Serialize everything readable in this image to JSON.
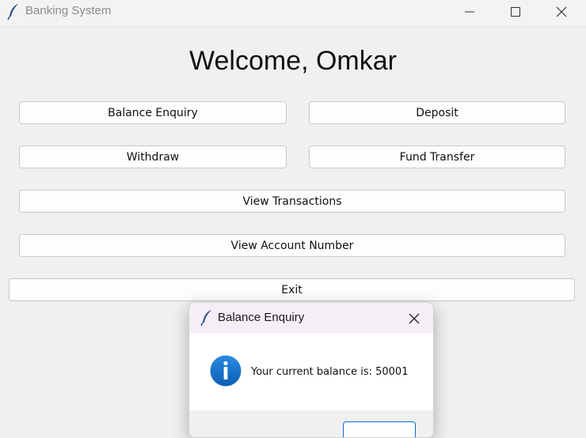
{
  "window": {
    "title": "Banking System",
    "icon": "feather-icon",
    "controls": [
      "minimize-icon",
      "maximize-icon",
      "close-icon"
    ]
  },
  "main": {
    "welcome": "Welcome, Omkar",
    "buttons": {
      "balance_enquiry": "Balance Enquiry",
      "deposit": "Deposit",
      "withdraw": "Withdraw",
      "fund_transfer": "Fund Transfer",
      "view_transactions": "View Transactions",
      "view_account_number": "View Account Number",
      "exit": "Exit"
    }
  },
  "dialog": {
    "title": "Balance Enquiry",
    "icon": "info-icon",
    "message": "Your current balance is: 50001",
    "accent_color": "#0b6ed1"
  }
}
